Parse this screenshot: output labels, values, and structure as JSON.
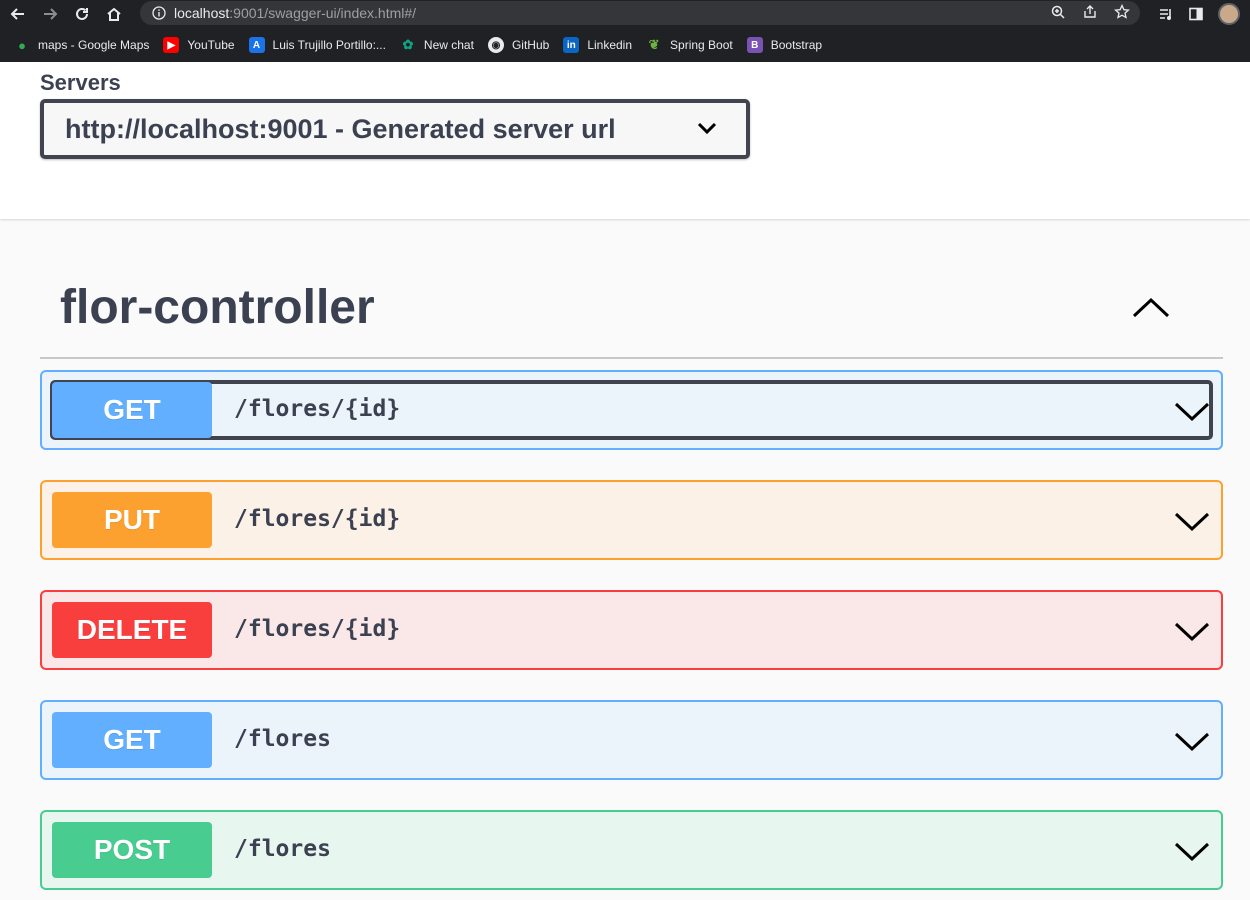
{
  "browser": {
    "url_host": "localhost",
    "url_rest": ":9001/swagger-ui/index.html#/",
    "bookmarks": [
      {
        "label": "maps - Google Maps",
        "icon": "google-maps-icon",
        "color": "#34a853"
      },
      {
        "label": "YouTube",
        "icon": "youtube-icon",
        "color": "#ff0000"
      },
      {
        "label": "Luis Trujillo Portillo:...",
        "icon": "a-logo-icon",
        "color": "#1a73e8"
      },
      {
        "label": "New chat",
        "icon": "chatgpt-icon",
        "color": "#10a37f"
      },
      {
        "label": "GitHub",
        "icon": "github-icon",
        "color": "#e8eaed"
      },
      {
        "label": "Linkedin",
        "icon": "linkedin-icon",
        "color": "#0a66c2"
      },
      {
        "label": "Spring Boot",
        "icon": "spring-icon",
        "color": "#6db33f"
      },
      {
        "label": "Bootstrap",
        "icon": "bootstrap-icon",
        "color": "#7952b3"
      }
    ]
  },
  "servers": {
    "label": "Servers",
    "selected": "http://localhost:9001 - Generated server url"
  },
  "tag": {
    "title": "flor-controller"
  },
  "operations": [
    {
      "method": "GET",
      "path": "/flores/{id}",
      "kind": "get",
      "focused": true
    },
    {
      "method": "PUT",
      "path": "/flores/{id}",
      "kind": "put",
      "focused": false
    },
    {
      "method": "DELETE",
      "path": "/flores/{id}",
      "kind": "delete",
      "focused": false
    },
    {
      "method": "GET",
      "path": "/flores",
      "kind": "get",
      "focused": false
    },
    {
      "method": "POST",
      "path": "/flores",
      "kind": "post",
      "focused": false
    }
  ],
  "colors": {
    "get": "#61affe",
    "put": "#fca130",
    "delete": "#f93e3e",
    "post": "#49cc90",
    "text": "#3b4151"
  }
}
